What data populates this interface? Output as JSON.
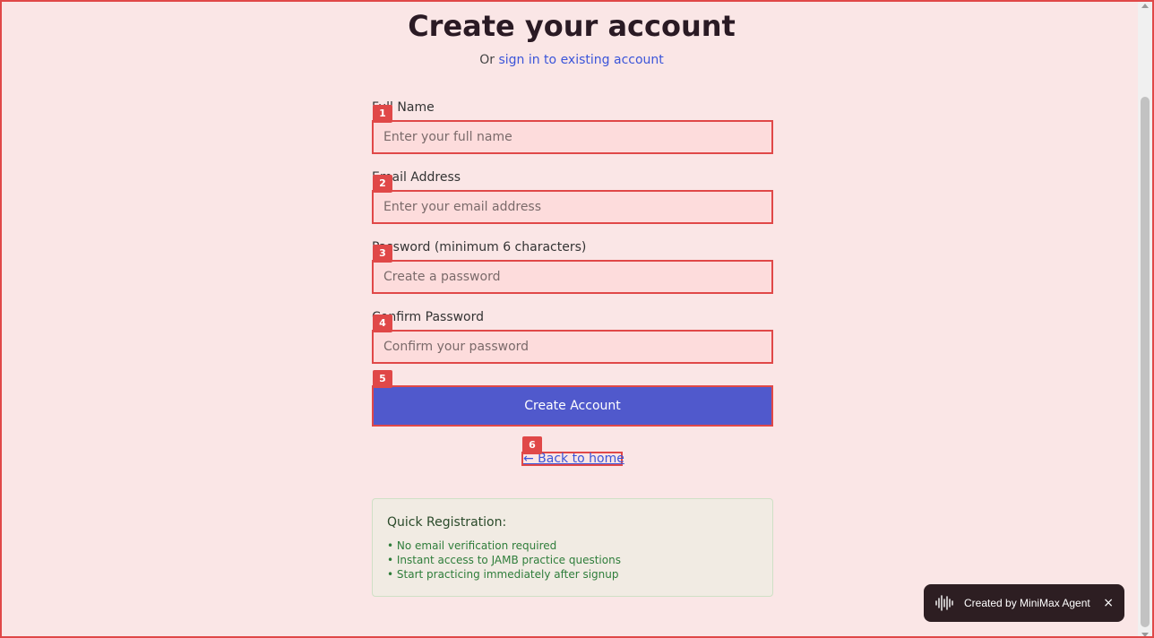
{
  "page": {
    "title": "Create your account",
    "subtitle_prefix": "Or",
    "signin_link": "sign in to existing account"
  },
  "form": {
    "full_name": {
      "label": "Full Name",
      "placeholder": "Enter your full name",
      "value": ""
    },
    "email": {
      "label": "Email Address",
      "placeholder": "Enter your email address",
      "value": ""
    },
    "password": {
      "label": "Password (minimum 6 characters)",
      "placeholder": "Create a password",
      "value": ""
    },
    "confirm_password": {
      "label": "Confirm Password",
      "placeholder": "Confirm your password",
      "value": ""
    },
    "submit_label": "Create Account"
  },
  "back_link": "← Back to home",
  "info": {
    "title": "Quick Registration:",
    "items": [
      "• No email verification required",
      "• Instant access to JAMB practice questions",
      "• Start practicing immediately after signup"
    ]
  },
  "badges": [
    "1",
    "2",
    "3",
    "4",
    "5",
    "6"
  ],
  "toast": {
    "text": "Created by MiniMax Agent",
    "close": "×"
  },
  "colors": {
    "background": "#fae6e6",
    "accent": "#5059cc",
    "link": "#3b55d9",
    "highlight": "#e04848",
    "info_text": "#2e7d3a"
  }
}
